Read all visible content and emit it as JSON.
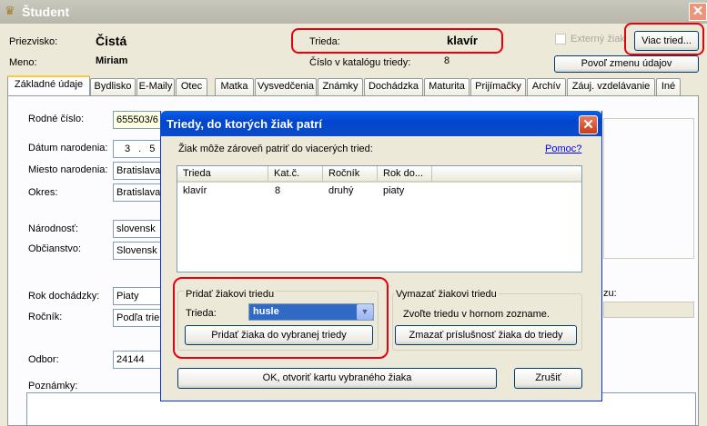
{
  "window": {
    "title": "Študent",
    "close": "✕"
  },
  "header": {
    "surname_label": "Priezvisko:",
    "surname_value": "Čistá",
    "firstname_label": "Meno:",
    "firstname_value": "Miriam",
    "class_label": "Trieda:",
    "class_value": "klavír",
    "catalog_label": "Číslo v katalógu triedy:",
    "catalog_value": "8",
    "external_label": "Externý žiak",
    "more_classes_button": "Viac tried...",
    "allow_change_button": "Povoľ zmenu údajov"
  },
  "tabs": [
    "Základné údaje",
    "Bydlisko",
    "E-Maily",
    "Otec",
    "Matka",
    "Vysvedčenia",
    "Známky",
    "Dochádzka",
    "Maturita",
    "Prijímačky",
    "Archív",
    "Záuj. vzdelávanie",
    "Iné"
  ],
  "form": {
    "birth_number_label": "Rodné číslo:",
    "birth_number_value": "655503/6",
    "birth_date_label": "Dátum narodenia:",
    "birth_date_value": "3 . 5 .",
    "birth_place_label": "Miesto narodenia:",
    "birth_place_value": "Bratislava",
    "district_label": "Okres:",
    "district_value": "Bratislava",
    "nationality_label": "Národnosť:",
    "nationality_value": "slovensk",
    "citizenship_label": "Občianstvo:",
    "citizenship_value": "Slovensk",
    "attendance_year_label": "Rok dochádzky:",
    "attendance_year_value": "Piaty",
    "grade_label": "Ročník:",
    "grade_value": "Podľa trie",
    "field_label": "Odbor:",
    "field_value": "24144",
    "notes_label": "Poznámky:",
    "right_partial_label": "zu:"
  },
  "dialog": {
    "title": "Triedy, do ktorých žiak patrí",
    "close": "✕",
    "info": "Žiak môže zároveň patriť do viacerých tried:",
    "help_link": "Pomoc?",
    "columns": [
      "Trieda",
      "Kat.č.",
      "Ročník",
      "Rok do..."
    ],
    "rows": [
      {
        "trieda": "klavír",
        "kat": "8",
        "rocnik": "druhý",
        "rok": "piaty"
      }
    ],
    "add_group": {
      "legend": "Pridať žiakovi triedu",
      "class_label": "Trieda:",
      "class_value": "husle",
      "add_button": "Pridať žiaka do vybranej triedy"
    },
    "remove_group": {
      "legend": "Vymazať žiakovi triedu",
      "hint": "Zvoľte triedu v hornom zozname.",
      "remove_button": "Zmazať príslušnosť žiaka do triedy"
    },
    "ok_button": "OK, otvoriť kartu vybraného žiaka",
    "cancel_button": "Zrušiť"
  }
}
